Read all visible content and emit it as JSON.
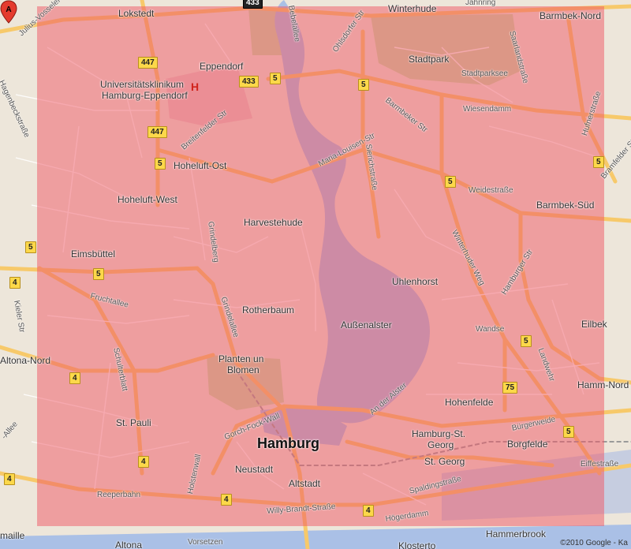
{
  "map": {
    "city_label": "Hamburg",
    "marker_label": "A",
    "copyright": "©2010 Google - Ka",
    "overlay_color": "#f05564"
  },
  "districts": [
    {
      "key": "lokstedt",
      "text": "Lokstedt"
    },
    {
      "key": "winterhude",
      "text": "Winterhude"
    },
    {
      "key": "barmbek_nord",
      "text": "Barmbek-Nord"
    },
    {
      "key": "eppendorf",
      "text": "Eppendorf"
    },
    {
      "key": "stadtpark",
      "text": "Stadtpark"
    },
    {
      "key": "stadtparksee",
      "text": "Stadtparksee"
    },
    {
      "key": "uke1",
      "text": "Universitätsklinikum"
    },
    {
      "key": "uke2",
      "text": "Hamburg-Eppendorf"
    },
    {
      "key": "hoheluft_ost",
      "text": "Hoheluft-Ost"
    },
    {
      "key": "hoheluft_west",
      "text": "Hoheluft-West"
    },
    {
      "key": "barmbek_sued",
      "text": "Barmbek-Süd"
    },
    {
      "key": "harvestehude",
      "text": "Harvestehude"
    },
    {
      "key": "eimsbuettel",
      "text": "Eimsbüttel"
    },
    {
      "key": "uhlenhorst",
      "text": "Uhlenhorst"
    },
    {
      "key": "rotherbaum",
      "text": "Rotherbaum"
    },
    {
      "key": "aussenalster",
      "text": "Außenalster"
    },
    {
      "key": "eilbek",
      "text": "Eilbek"
    },
    {
      "key": "wandse",
      "text": "Wandse"
    },
    {
      "key": "altona_nord",
      "text": "Altona-Nord"
    },
    {
      "key": "planten1",
      "text": "Planten un"
    },
    {
      "key": "planten2",
      "text": "Blomen"
    },
    {
      "key": "hamm_nord",
      "text": "Hamm-Nord"
    },
    {
      "key": "hohenfelde",
      "text": "Hohenfelde"
    },
    {
      "key": "st_pauli",
      "text": "St. Pauli"
    },
    {
      "key": "hamburg_st_georg1",
      "text": "Hamburg-St."
    },
    {
      "key": "hamburg_st_georg2",
      "text": "Georg"
    },
    {
      "key": "borgfelde",
      "text": "Borgfelde"
    },
    {
      "key": "st_georg",
      "text": "St. Georg"
    },
    {
      "key": "neustadt",
      "text": "Neustadt"
    },
    {
      "key": "altstadt",
      "text": "Altstadt"
    },
    {
      "key": "hammerbrook",
      "text": "Hammerbrook"
    },
    {
      "key": "altona",
      "text": "Altona"
    },
    {
      "key": "klosterto",
      "text": "Klosterto"
    },
    {
      "key": "wimaille",
      "text": "maille"
    }
  ],
  "streets": [
    {
      "key": "julius_vosseler",
      "text": "Julius-Vosseler-Straße"
    },
    {
      "key": "bebelallee",
      "text": "Bebelallee"
    },
    {
      "key": "ohlsdorfer",
      "text": "Ohlsdorfer Str"
    },
    {
      "key": "jahnring",
      "text": "Jahnring"
    },
    {
      "key": "saarland",
      "text": "Saarlandstraße"
    },
    {
      "key": "wiesendamm",
      "text": "Wiesendamm"
    },
    {
      "key": "barmbeker",
      "text": "Barmbeker Str"
    },
    {
      "key": "huebeck",
      "text": "Hagenbeckstraße"
    },
    {
      "key": "breitenfelder",
      "text": "Breitenfelder Str"
    },
    {
      "key": "maria_louisen",
      "text": "Maria-Louisen-Str"
    },
    {
      "key": "sierich",
      "text": "Sierichstraße"
    },
    {
      "key": "huxter",
      "text": "Hufnerstraße"
    },
    {
      "key": "bramfelder",
      "text": "Bramfelder Str"
    },
    {
      "key": "weidestr",
      "text": "Weidestraße"
    },
    {
      "key": "grindelberg",
      "text": "Grindelberg"
    },
    {
      "key": "winterhuder_weg",
      "text": "Winterhuder Weg"
    },
    {
      "key": "hamburger_str",
      "text": "Hamburger Str"
    },
    {
      "key": "fruchtallee",
      "text": "Fruchtallee"
    },
    {
      "key": "grindelallee",
      "text": "Grindelallee"
    },
    {
      "key": "kieler",
      "text": "Kieler Str"
    },
    {
      "key": "landwehr",
      "text": "Landwehr"
    },
    {
      "key": "schulterblatt",
      "text": "Schulterblatt"
    },
    {
      "key": "an_der_alster",
      "text": "An der Alster"
    },
    {
      "key": "gorch_fock",
      "text": "Gorch-Fock-Wall"
    },
    {
      "key": "buergerweide",
      "text": "Bürgerweide"
    },
    {
      "key": "holstenwall",
      "text": "Holstenwall"
    },
    {
      "key": "eiffestr",
      "text": "Eiffestraße"
    },
    {
      "key": "spalding",
      "text": "Spaldingstraße"
    },
    {
      "key": "reeperbahn",
      "text": "Reeperbahn"
    },
    {
      "key": "willy_brandt",
      "text": "Willy-Brandt-Straße"
    },
    {
      "key": "hoegerdamm",
      "text": "Högerdamm"
    },
    {
      "key": "vorsetzen",
      "text": "Vorsetzen"
    },
    {
      "key": "allee",
      "text": "-Allee"
    }
  ],
  "shields": [
    "433",
    "447",
    "433",
    "5",
    "5",
    "447",
    "5",
    "5",
    "5",
    "5",
    "4",
    "5",
    "75",
    "5",
    "4",
    "4",
    "4",
    "4",
    "4",
    "5"
  ]
}
